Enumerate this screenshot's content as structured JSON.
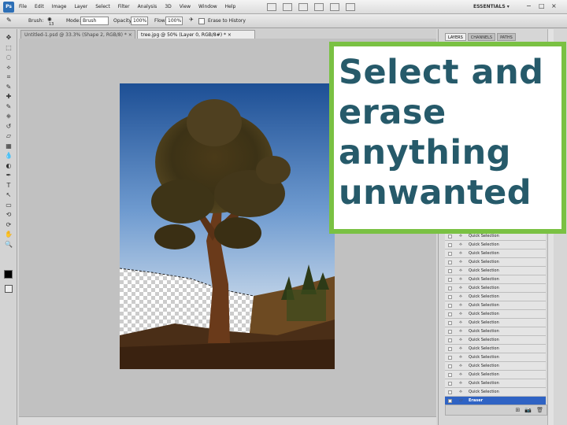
{
  "app": {
    "logo": "Ps",
    "menu": [
      "File",
      "Edit",
      "Image",
      "Layer",
      "Select",
      "Filter",
      "Analysis",
      "3D",
      "View",
      "Window",
      "Help"
    ],
    "workspace": "ESSENTIALS ▾",
    "window_controls": [
      "−",
      "□",
      "×"
    ]
  },
  "options_bar": {
    "brush_label": "Brush:",
    "brush_size": "13",
    "mode_label": "Mode:",
    "mode_value": "Brush",
    "opacity_label": "Opacity:",
    "opacity_value": "100%",
    "flow_label": "Flow:",
    "flow_value": "100%",
    "erase_history_label": "Erase to History"
  },
  "tabs": [
    {
      "label": "Untitled-1.psd @ 33.3% (Shape 2, RGB/8) *  ×"
    },
    {
      "label": "tree.jpg @ 50% (Layer 0, RGB/8#) *  ×"
    }
  ],
  "toolbox": {
    "icons": [
      "move-icon",
      "marquee-icon",
      "lasso-icon",
      "quick-selection-icon",
      "crop-icon",
      "eyedropper-icon",
      "healing-brush-icon",
      "brush-icon",
      "clone-stamp-icon",
      "history-brush-icon",
      "eraser-icon",
      "gradient-icon",
      "blur-icon",
      "dodge-icon",
      "pen-icon",
      "type-icon",
      "path-selection-icon",
      "shape-icon",
      "3d-rotate-icon",
      "3d-orbit-icon",
      "hand-icon",
      "zoom-icon"
    ],
    "glyphs": [
      "✥",
      "⬚",
      "◌",
      "⟡",
      "⌗",
      "✎",
      "✚",
      "✎",
      "⎈",
      "↺",
      "▱",
      "▦",
      "💧",
      "◐",
      "✒",
      "T",
      "↖",
      "▭",
      "⟲",
      "⟳",
      "✋",
      "🔍"
    ]
  },
  "panels": {
    "tabs": [
      "LAYERS",
      "CHANNELS",
      "PATHS"
    ],
    "history": [
      {
        "label": "Quick Selection",
        "icon": "quick-selection-icon"
      },
      {
        "label": "Quick Selection",
        "icon": "quick-selection-icon"
      },
      {
        "label": "Quick Selection",
        "icon": "quick-selection-icon"
      },
      {
        "label": "Quick Selection",
        "icon": "quick-selection-icon"
      },
      {
        "label": "Quick Selection",
        "icon": "quick-selection-icon"
      },
      {
        "label": "Quick Selection",
        "icon": "quick-selection-icon"
      },
      {
        "label": "Quick Selection",
        "icon": "quick-selection-icon"
      },
      {
        "label": "Quick Selection",
        "icon": "quick-selection-icon"
      },
      {
        "label": "Quick Selection",
        "icon": "quick-selection-icon"
      },
      {
        "label": "Quick Selection",
        "icon": "quick-selection-icon"
      },
      {
        "label": "Quick Selection",
        "icon": "quick-selection-icon"
      },
      {
        "label": "Quick Selection",
        "icon": "quick-selection-icon"
      },
      {
        "label": "Quick Selection",
        "icon": "quick-selection-icon"
      },
      {
        "label": "Quick Selection",
        "icon": "quick-selection-icon"
      },
      {
        "label": "Quick Selection",
        "icon": "quick-selection-icon"
      },
      {
        "label": "Quick Selection",
        "icon": "quick-selection-icon"
      },
      {
        "label": "Quick Selection",
        "icon": "quick-selection-icon"
      },
      {
        "label": "Quick Selection",
        "icon": "quick-selection-icon"
      },
      {
        "label": "Quick Selection",
        "icon": "quick-selection-icon"
      },
      {
        "label": "Eraser",
        "icon": "eraser-icon",
        "selected": true
      }
    ],
    "bottom_icons": [
      "⊞",
      "📷",
      "🗑"
    ]
  },
  "callout": {
    "lines": [
      "Select and",
      "erase",
      "anything",
      "unwanted"
    ],
    "text_color": "#265a6a",
    "border_color": "#7ac143"
  }
}
